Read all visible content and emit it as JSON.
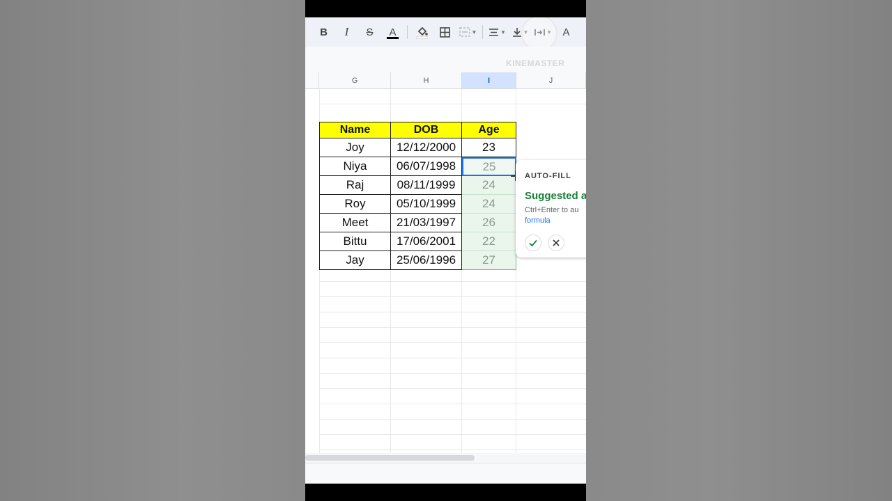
{
  "toolbar": {
    "bold": "B",
    "italic": "I",
    "strike": "S",
    "text_color": "A",
    "fill_icon": "paint-bucket-icon",
    "borders_icon": "borders-icon",
    "merge_icon": "merge-icon",
    "align_icon": "align-icon",
    "valign_icon": "vertical-align-icon",
    "wrap_icon": "text-wrap-icon",
    "rotate_label": "A"
  },
  "watermark": "KINEMASTER",
  "columns": [
    "G",
    "H",
    "I",
    "J"
  ],
  "table": {
    "headers": [
      "Name",
      "DOB",
      "Age"
    ],
    "rows": [
      {
        "name": "Joy",
        "dob": "12/12/2000",
        "age": "23"
      },
      {
        "name": "Niya",
        "dob": "06/07/1998",
        "age": "25"
      },
      {
        "name": "Raj",
        "dob": "08/11/1999",
        "age": "24"
      },
      {
        "name": "Roy",
        "dob": "05/10/1999",
        "age": "24"
      },
      {
        "name": "Meet",
        "dob": "21/03/1997",
        "age": "26"
      },
      {
        "name": "Bittu",
        "dob": "17/06/2001",
        "age": "22"
      },
      {
        "name": "Jay",
        "dob": "25/06/1996",
        "age": "27"
      }
    ]
  },
  "popup": {
    "title": "AUTO-FILL",
    "suggestion": "Suggested a",
    "hint": "Ctrl+Enter to au",
    "link": "formula",
    "accept_icon": "check-icon",
    "dismiss_icon": "close-icon"
  },
  "colors": {
    "header_fill": "#ffff00",
    "suggest_text": "#188038",
    "selected_col": "#d3e3fd",
    "active_border": "#1a73e8"
  }
}
